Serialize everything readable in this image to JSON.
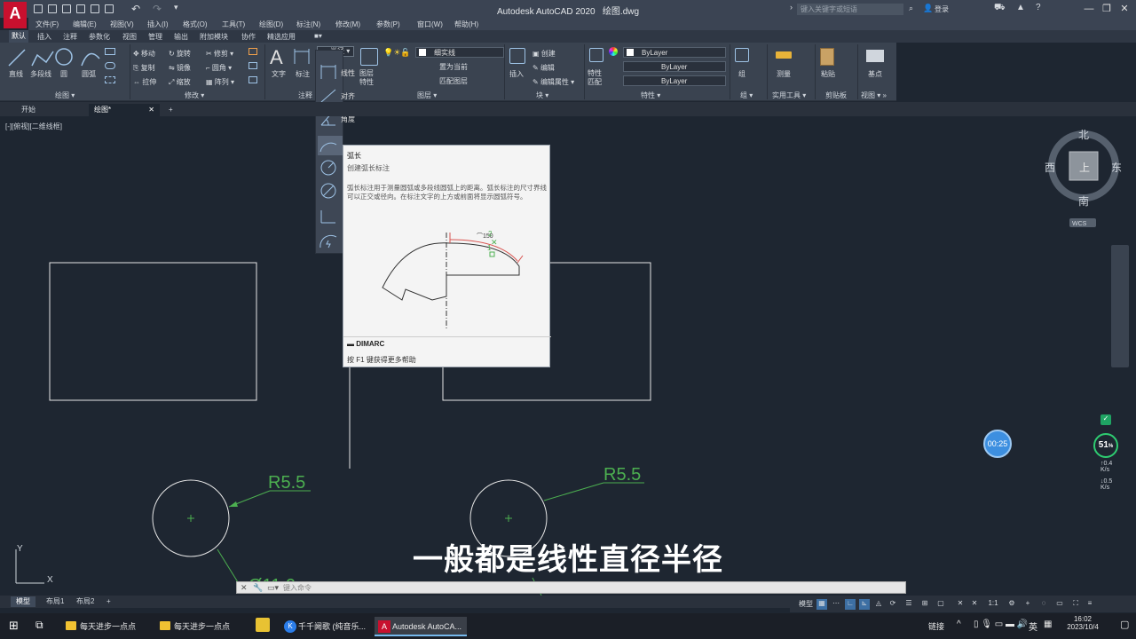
{
  "window": {
    "title": "Autodesk AutoCAD 2020",
    "filename": "绘图.dwg",
    "search_placeholder": "键入关键字或短语",
    "login": "登录"
  },
  "menus": [
    "文件(F)",
    "编辑(E)",
    "视图(V)",
    "插入(I)",
    "格式(O)",
    "工具(T)",
    "绘图(D)",
    "标注(N)",
    "修改(M)",
    "参数(P)",
    "窗口(W)",
    "帮助(H)"
  ],
  "ribbon_tabs": [
    "默认",
    "插入",
    "注释",
    "参数化",
    "视图",
    "管理",
    "输出",
    "附加模块",
    "协作",
    "精选应用"
  ],
  "ribbon": {
    "draw": {
      "title": "绘图",
      "line": "直线",
      "polyline": "多段线",
      "circle": "圆",
      "arc": "圆弧"
    },
    "modify": {
      "title": "修改",
      "items": [
        "移动",
        "旋转",
        "修剪",
        "复制",
        "镜像",
        "圆角",
        "拉伸",
        "缩放",
        "阵列"
      ]
    },
    "annotation": {
      "title": "注释",
      "text": "文字",
      "dimension": "标注",
      "radius_combo": "半径"
    },
    "layers": {
      "title": "图层",
      "props": "图层特性",
      "combo": "细实线",
      "set_current": "置为当前",
      "match": "匹配图层"
    },
    "block": {
      "title": "块",
      "insert": "插入",
      "create": "创建",
      "edit": "编辑",
      "edit_attr": "编辑属性"
    },
    "properties": {
      "title": "特性",
      "match": "特性匹配",
      "bylayer1": "ByLayer",
      "bylayer2": "ByLayer",
      "bylayer3": "ByLayer"
    },
    "groups": {
      "title": "组",
      "group": "组"
    },
    "utilities": {
      "title": "实用工具",
      "measure": "测量"
    },
    "clipboard": {
      "title": "剪贴板",
      "paste": "粘贴"
    },
    "view": {
      "title": "视图",
      "base": "基点"
    }
  },
  "doc_tabs": [
    "开始",
    "绘图*"
  ],
  "viewport_label": "[-][俯视][二维线框]",
  "dim_dropdown": [
    "线性",
    "对齐",
    "角度",
    "弧长",
    "半径",
    "直径",
    "坐标",
    "折弯"
  ],
  "tooltip": {
    "title": "弧长",
    "subtitle": "创建弧长标注",
    "description": "弧长标注用于测量圆弧或多段线圆弧上的距离。弧长标注的尺寸界线可以正交或径向。在标注文字的上方或前面将显示圆弧符号。",
    "dim_value": "⌒150",
    "command": "DIMARC",
    "help": "按 F1 键获得更多帮助"
  },
  "drawing": {
    "label_r1": "R5.5",
    "label_r2": "R5.5",
    "label_d1": "Ø11.0",
    "axis_x": "X",
    "axis_y": "Y"
  },
  "viewcube": {
    "north": "北",
    "south": "南",
    "east": "东",
    "west": "西",
    "top": "上",
    "wcs": "WCS"
  },
  "subtitle": "一般都是线性直径半径",
  "timer": "00:25",
  "meter": {
    "value": "51",
    "unit": "%",
    "up": "0.4",
    "down": "0.5",
    "rate_unit": "K/s"
  },
  "command_line": {
    "placeholder": "键入命令"
  },
  "layout_tabs": [
    "模型",
    "布局1",
    "布局2"
  ],
  "status": {
    "model": "模型"
  },
  "taskbar": {
    "items": [
      "每天进步一点点",
      "每天进步一点点",
      "千千阙歌 (纯音乐...",
      "Autodesk AutoCA..."
    ],
    "link": "链接",
    "ime": "英",
    "time": "16:02",
    "date": "2023/10/4"
  }
}
